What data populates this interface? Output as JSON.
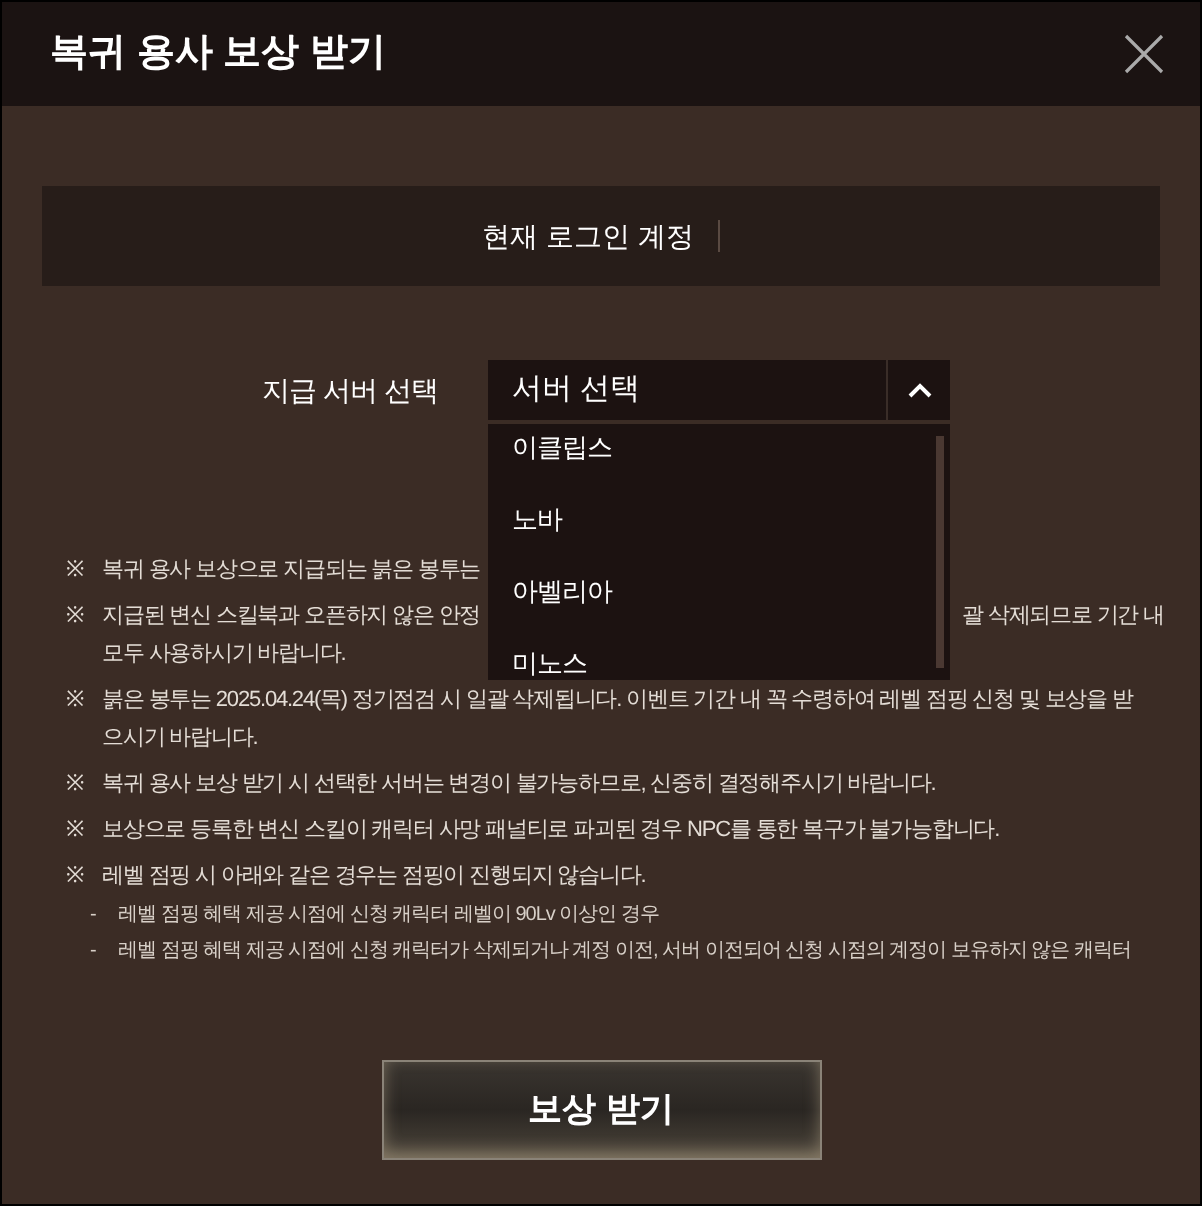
{
  "title": "복귀 용사 보상 받기",
  "account": {
    "label": "현재 로그인 계정"
  },
  "server_select": {
    "label": "지급 서버 선택",
    "value": "서버 선택",
    "expanded": true,
    "options": [
      {
        "label": "이클립스"
      },
      {
        "label": "노바"
      },
      {
        "label": "아벨리아"
      },
      {
        "label": "미노스"
      }
    ]
  },
  "notes": [
    {
      "bullet": "※",
      "lines": [
        [
          "복귀 용사 보상으로 지급되는 붉은 봉투는"
        ]
      ]
    },
    {
      "bullet": "※",
      "lines": [
        [
          "지급된 변신 스킬북과 오픈하지 않은 안정",
          "괄 삭제되므로 기간 내"
        ],
        [
          "모두 사용하시기 바랍니다."
        ]
      ]
    },
    {
      "bullet": "※",
      "text": "붉은 봉투는 2025.04.24(목) 정기점검 시 일괄 삭제됩니다. 이벤트 기간 내 꼭 수령하여 레벨 점핑 신청 및 보상을 받으시기 바랍니다."
    },
    {
      "bullet": "※",
      "text": "복귀 용사 보상 받기 시 선택한 서버는 변경이 불가능하므로, 신중히 결정해주시기 바랍니다."
    },
    {
      "bullet": "※",
      "text": "보상으로 등록한 변신 스킬이 캐릭터 사망 패널티로 파괴된 경우 NPC를 통한 복구가 불가능합니다."
    },
    {
      "bullet": "※",
      "text": "레벨 점핑 시 아래와 같은 경우는 점핑이 진행되지 않습니다.",
      "children": [
        {
          "bullet": "-",
          "text": "레벨 점핑 혜택 제공 시점에 신청 캐릭터 레벨이 90Lv 이상인 경우"
        },
        {
          "bullet": "-",
          "text": "레벨 점핑 혜택 제공 시점에 신청 캐릭터가 삭제되거나 계정 이전, 서버 이전되어 신청 시점의 계정이 보유하지 않은 캐릭터"
        }
      ]
    }
  ],
  "submit_button": "보상 받기"
}
